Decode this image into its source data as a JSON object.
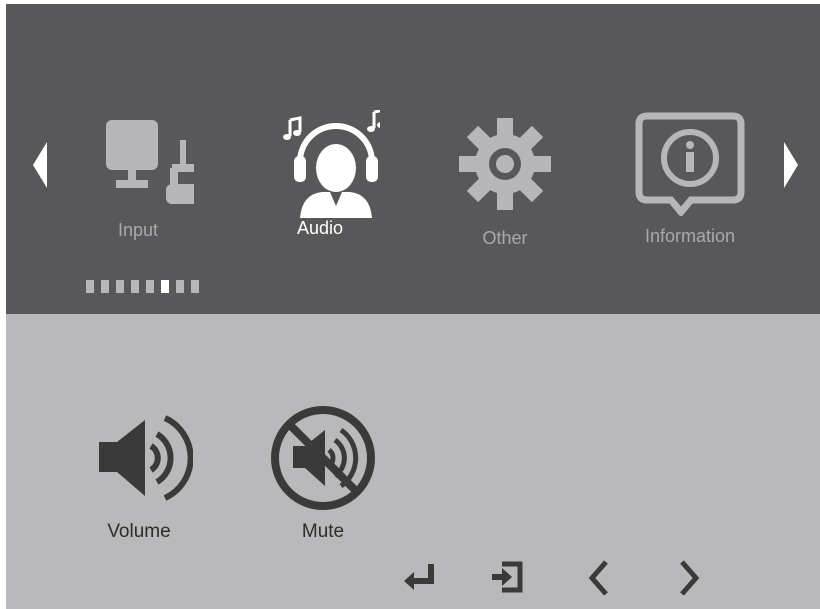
{
  "menu": {
    "tabs": [
      {
        "label": "Input",
        "icon": "monitor-input-icon"
      },
      {
        "label": "Audio",
        "icon": "headphones-person-icon",
        "active": true
      },
      {
        "label": "Other",
        "icon": "gear-icon"
      },
      {
        "label": "Information",
        "icon": "info-bubble-icon"
      }
    ],
    "page_indicator": {
      "total": 8,
      "current": 6
    }
  },
  "audio": {
    "items": [
      {
        "label": "Volume",
        "icon": "speaker-icon"
      },
      {
        "label": "Mute",
        "icon": "mute-icon"
      }
    ]
  },
  "navigation": [
    "enter-icon",
    "exit-icon",
    "chevron-left-icon",
    "chevron-right-icon"
  ],
  "colors": {
    "top_panel": "#58585a",
    "bottom_panel": "#b9b9bb",
    "inactive": "#b7b7b9",
    "active": "#ffffff"
  }
}
